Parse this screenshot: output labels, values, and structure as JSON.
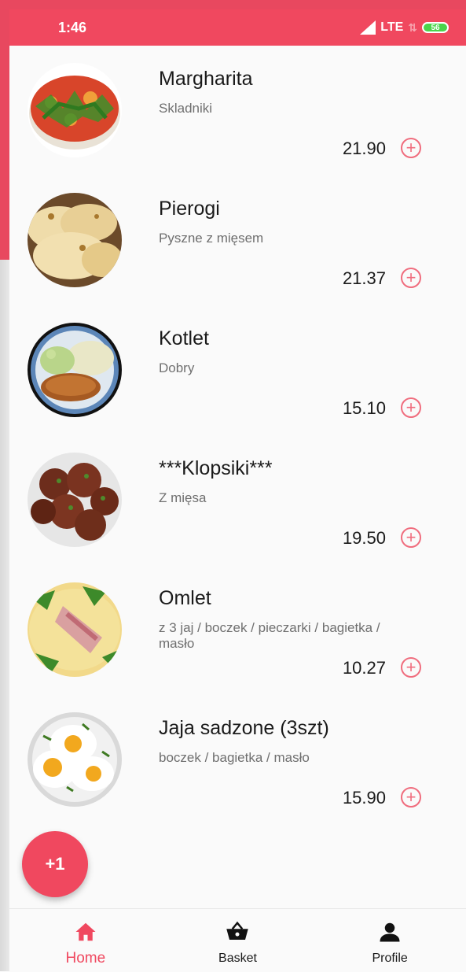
{
  "status_bar": {
    "time": "1:46",
    "network": "LTE",
    "battery": "56"
  },
  "menu": {
    "items": [
      {
        "name": "Margharita",
        "description": "Skladniki",
        "price": "21.90",
        "image_icon": "pizza-photo"
      },
      {
        "name": "Pierogi",
        "description": "Pyszne z mięsem",
        "price": "21.37",
        "image_icon": "pierogi-photo"
      },
      {
        "name": "Kotlet",
        "description": "Dobry",
        "price": "15.10",
        "image_icon": "kotlet-photo"
      },
      {
        "name": "***Klopsiki***",
        "description": "Z mięsa",
        "price": "19.50",
        "image_icon": "meatballs-photo"
      },
      {
        "name": "Omlet",
        "description": "z 3 jaj / boczek / pieczarki / bagietka / masło",
        "price": "10.27",
        "image_icon": "omelette-photo"
      },
      {
        "name": "Jaja sadzone (3szt)",
        "description": "boczek / bagietka / masło",
        "price": "15.90",
        "image_icon": "fried-eggs-photo"
      }
    ],
    "add_icon": "plus-circle-icon"
  },
  "fab": {
    "label": "+1"
  },
  "bottom_nav": {
    "home": "Home",
    "basket": "Basket",
    "profile": "Profile",
    "active": "home"
  },
  "colors": {
    "accent": "#f0485f",
    "add_icon": "#f06d7e",
    "text_primary": "#1a1a1a",
    "text_secondary": "#6f6f6f",
    "background": "#fafafa"
  }
}
